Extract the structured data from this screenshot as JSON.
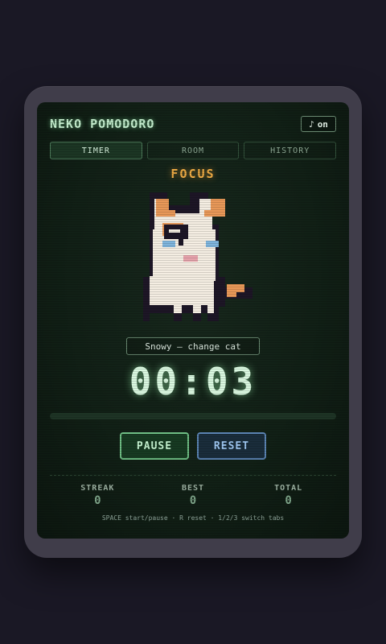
{
  "app": {
    "title": "NEKO POMODORO"
  },
  "sound": {
    "icon": "♪",
    "label": "on"
  },
  "tabs": [
    {
      "label": "TIMER",
      "active": true
    },
    {
      "label": "ROOM",
      "active": false
    },
    {
      "label": "HISTORY",
      "active": false
    }
  ],
  "mode": {
    "label": "FOCUS",
    "color": "#f0ac45"
  },
  "cat": {
    "button_label": "Snowy — change cat"
  },
  "timer": {
    "display": "00:03"
  },
  "progress": {
    "fraction": 0.0
  },
  "buttons": {
    "pause": "PAUSE",
    "reset": "RESET"
  },
  "stats": [
    {
      "label": "STREAK",
      "value": "0"
    },
    {
      "label": "BEST",
      "value": "0"
    },
    {
      "label": "TOTAL",
      "value": "0"
    }
  ],
  "hint": "SPACE start/pause · R reset · 1/2/3 switch tabs",
  "colors": {
    "accent": "#5fe08a",
    "focus": "#f0ac45",
    "reset": "#9fc8f2"
  }
}
